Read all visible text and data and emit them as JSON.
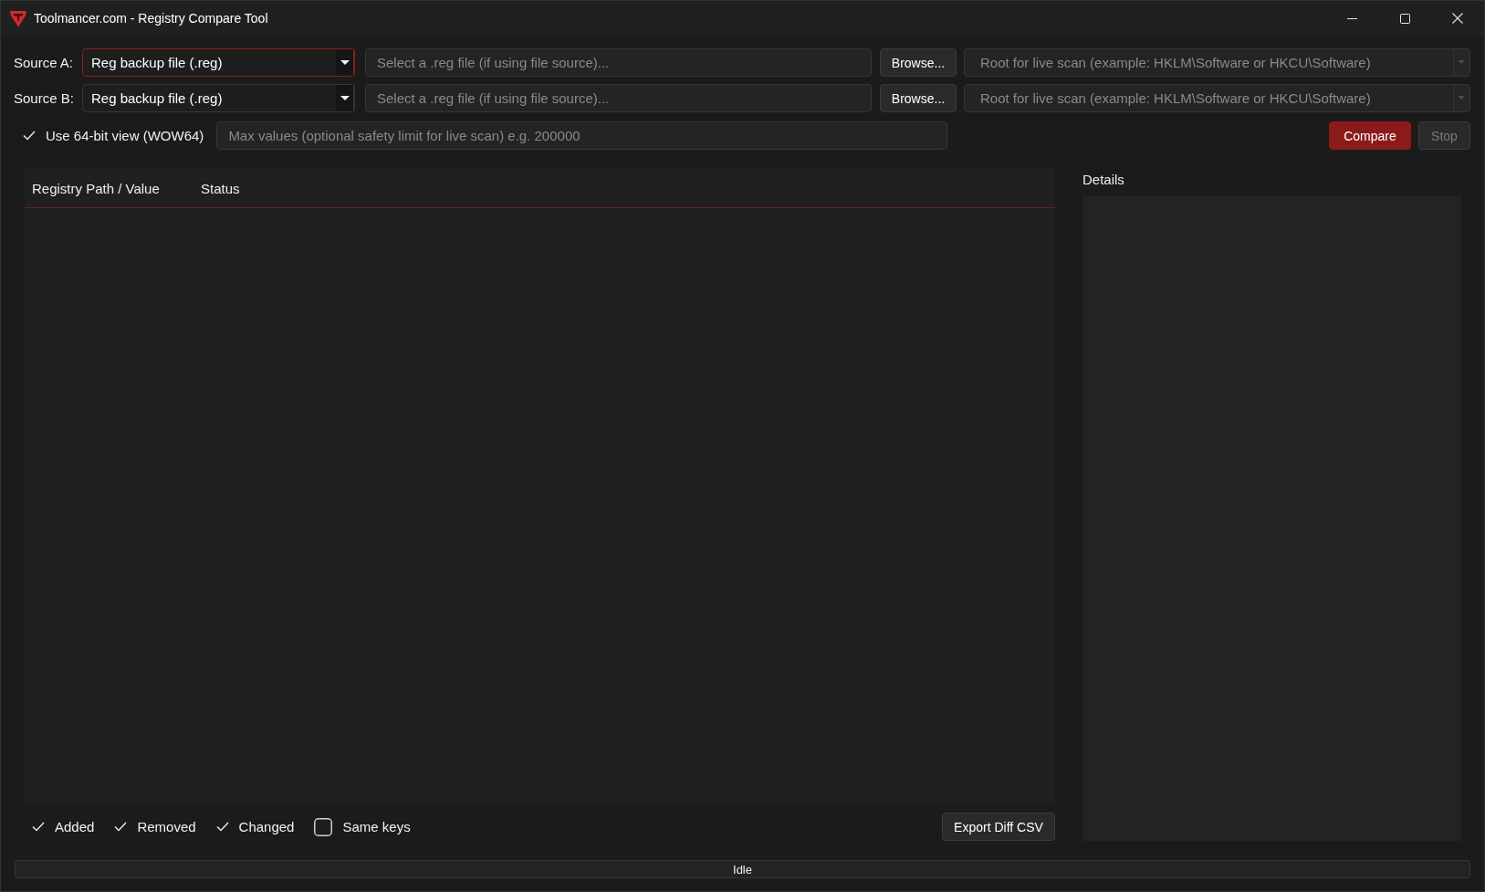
{
  "window": {
    "title": "Toolmancer.com - Registry Compare Tool"
  },
  "sources": [
    {
      "label": "Source A:",
      "type": {
        "value": "Reg backup file (.reg)",
        "focused": true
      },
      "file": {
        "placeholder": "Select a .reg file (if using file source)..."
      },
      "browse": "Browse...",
      "root": {
        "placeholder": "Root for live scan (example: HKLM\\Software or HKCU\\Software)",
        "disabled": true
      }
    },
    {
      "label": "Source B:",
      "type": {
        "value": "Reg backup file (.reg)",
        "focused": false
      },
      "file": {
        "placeholder": "Select a .reg file (if using file source)..."
      },
      "browse": "Browse...",
      "root": {
        "placeholder": "Root for live scan (example: HKLM\\Software or HKCU\\Software)",
        "disabled": true
      }
    }
  ],
  "options": {
    "wow64": {
      "label": "Use 64-bit view (WOW64)",
      "checked": true
    },
    "max_values": {
      "placeholder": "Max values (optional safety limit for live scan) e.g. 200000"
    },
    "actions": [
      {
        "label": "Compare",
        "kind": "primary",
        "disabled": false
      },
      {
        "label": "Stop",
        "kind": "secondary",
        "disabled": true
      }
    ]
  },
  "table": {
    "columns": [
      "Registry Path / Value",
      "Status"
    ]
  },
  "details": {
    "title": "Details"
  },
  "filters": [
    {
      "label": "Added",
      "checked": true
    },
    {
      "label": "Removed",
      "checked": true
    },
    {
      "label": "Changed",
      "checked": true
    },
    {
      "label": "Same keys",
      "checked": false
    }
  ],
  "export_button": {
    "label": "Export Diff CSV"
  },
  "status_bar": {
    "text": "Idle"
  }
}
